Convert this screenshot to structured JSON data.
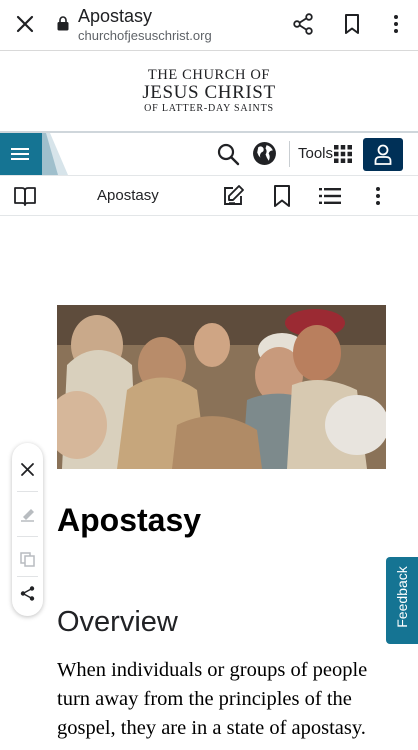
{
  "browser": {
    "page_title": "Apostasy",
    "url": "churchofjesuschrist.org",
    "icons": [
      "close-icon",
      "lock-icon",
      "share-icon",
      "bookmark-icon",
      "more-vert-icon"
    ]
  },
  "logo": {
    "line1": "THE CHURCH OF",
    "line2": "JESUS CHRIST",
    "line3": "OF LATTER-DAY SAINTS"
  },
  "nav": {
    "tools_label": "Tools",
    "accent_color": "#157493",
    "account_color": "#003057"
  },
  "toolbar": {
    "title": "Apostasy"
  },
  "article": {
    "title": "Apostasy",
    "section_heading": "Overview",
    "paragraph": "When individuals or groups of people turn away from the principles of the gospel, they are in a state of apostasy."
  },
  "feedback": {
    "label": "Feedback"
  }
}
